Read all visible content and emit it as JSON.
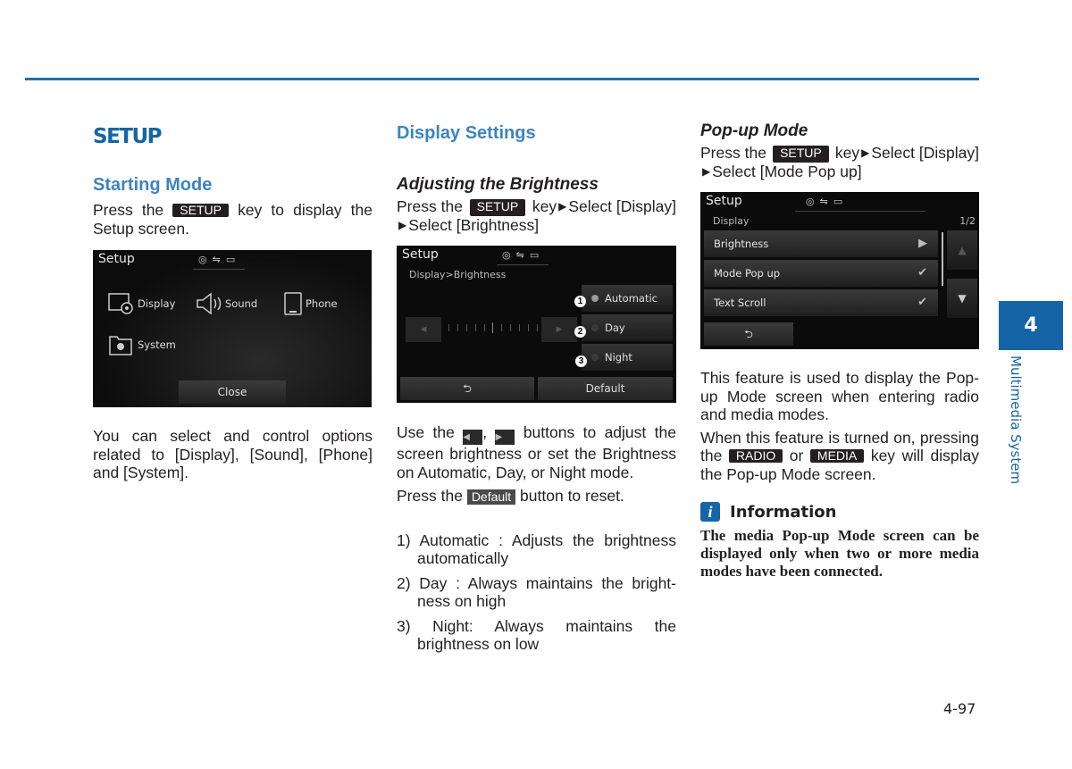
{
  "header": {
    "accent_color": "#1565a6"
  },
  "col1": {
    "section_title": "SETUP",
    "subsection_title": "Starting Mode",
    "intro": {
      "before": "Press the",
      "key": "SETUP",
      "after": "key to display the Setup screen."
    },
    "screen": {
      "title": "Setup",
      "status_icons": [
        "disc-icon",
        "usb-icon",
        "aux-icon"
      ],
      "items": [
        {
          "label": "Display",
          "icon": "display-gear-icon"
        },
        {
          "label": "Sound",
          "icon": "speaker-icon"
        },
        {
          "label": "Phone",
          "icon": "phone-icon"
        },
        {
          "label": "System",
          "icon": "folder-gear-icon"
        }
      ],
      "close_label": "Close"
    },
    "description": "You can select and control options related to [Display], [Sound], [Phone] and [System]."
  },
  "col2": {
    "section_title": "Display Settings",
    "subsection_title": "Adjusting the Brightness",
    "instruction": {
      "before": "Press the",
      "key": "SETUP",
      "mid": "key",
      "step1": "Select [Display]",
      "step2": "Select [Brightness]"
    },
    "screen": {
      "title": "Setup",
      "breadcrumb": "Display>Brightness",
      "options": [
        {
          "num": "1",
          "label": "Automatic",
          "selected": true
        },
        {
          "num": "2",
          "label": "Day",
          "selected": false
        },
        {
          "num": "3",
          "label": "Night",
          "selected": false
        }
      ],
      "back_icon": "back-arrow-icon",
      "default_label": "Default"
    },
    "use_text": {
      "before": "Use the",
      "left_btn": "◀",
      "sep": ",",
      "right_btn": "▶",
      "after": "buttons to adjust the screen brightness or set the Brightness on Automatic, Day, or Night mode."
    },
    "reset_text": {
      "before": "Press the",
      "key": "Default",
      "after": "button to reset."
    },
    "list": [
      "1) Automatic : Adjusts the brightness automatically",
      "2) Day : Always maintains the bright-ness on high",
      "3) Night: Always maintains the brightness on low"
    ]
  },
  "col3": {
    "subsection_title": "Pop-up Mode",
    "instruction": {
      "before": "Press the",
      "key": "SETUP",
      "mid": "key",
      "step1": "Select [Display]",
      "step2": "Select [Mode Pop up]"
    },
    "screen": {
      "title": "Setup",
      "breadcrumb": "Display",
      "page": "1/2",
      "rows": [
        {
          "label": "Brightness",
          "mark": "▶"
        },
        {
          "label": "Mode Pop up",
          "mark": "✔"
        },
        {
          "label": "Text Scroll",
          "mark": "✔"
        }
      ]
    },
    "feature_text": "This feature is used to display the Pop-up Mode screen when entering radio and media modes.",
    "turned_on_text": {
      "before": "When this feature is turned on, pressing the",
      "key1": "RADIO",
      "or": "or",
      "key2": "MEDIA",
      "after": "key will display the Pop-up Mode screen."
    },
    "info": {
      "title": "Information",
      "icon_glyph": "i",
      "body": "The media Pop-up Mode screen can be displayed only when two or more media modes have been connected."
    }
  },
  "chapter": {
    "number": "4",
    "label": "Multimedia System"
  },
  "page_number": "4-97"
}
